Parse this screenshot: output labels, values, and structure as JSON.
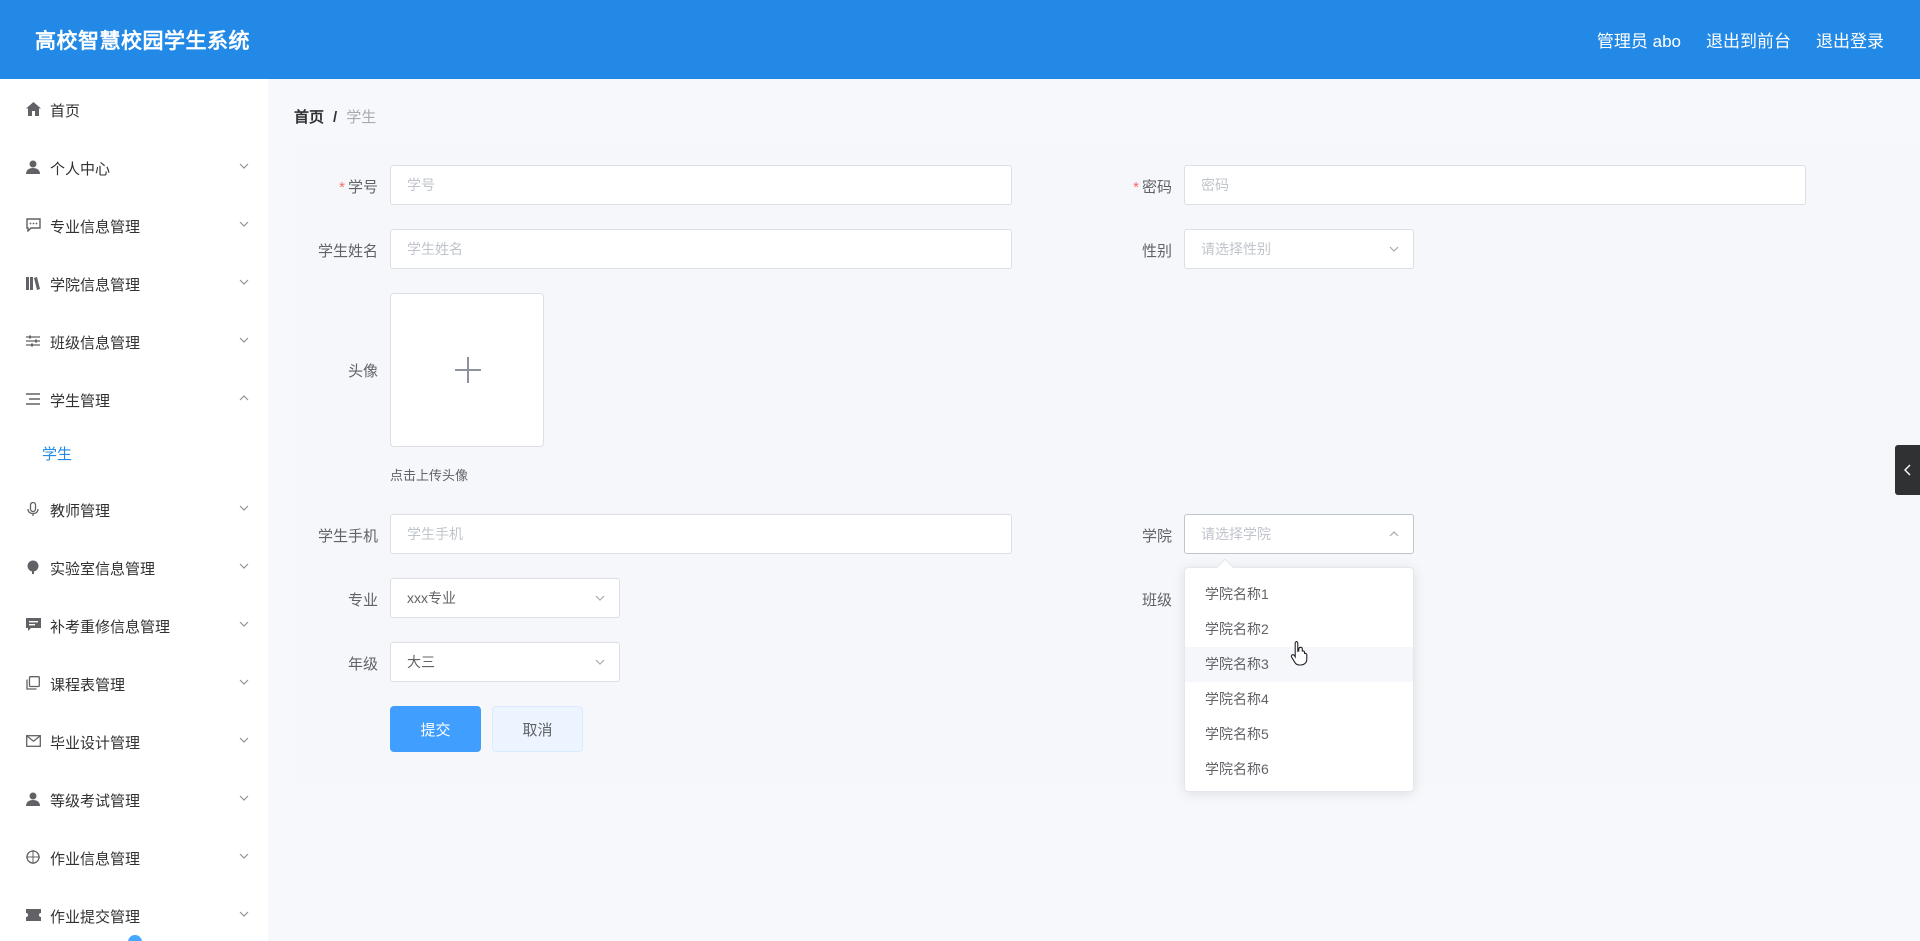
{
  "header": {
    "title": "高校智慧校园学生系统",
    "admin": "管理员 abo",
    "to_front": "退出到前台",
    "logout": "退出登录"
  },
  "sidebar": {
    "items": [
      {
        "label": "首页",
        "icon": "home-icon"
      },
      {
        "label": "个人中心",
        "icon": "user-icon"
      },
      {
        "label": "专业信息管理",
        "icon": "chat-icon"
      },
      {
        "label": "学院信息管理",
        "icon": "books-icon"
      },
      {
        "label": "班级信息管理",
        "icon": "sliders-icon"
      },
      {
        "label": "学生管理",
        "icon": "list-icon"
      },
      {
        "label": "教师管理",
        "icon": "microphone-icon"
      },
      {
        "label": "实验室信息管理",
        "icon": "flask-icon"
      },
      {
        "label": "补考重修信息管理",
        "icon": "message-icon"
      },
      {
        "label": "课程表管理",
        "icon": "copy-icon"
      },
      {
        "label": "毕业设计管理",
        "icon": "mail-icon"
      },
      {
        "label": "等级考试管理",
        "icon": "user-icon"
      },
      {
        "label": "作业信息管理",
        "icon": "target-icon"
      },
      {
        "label": "作业提交管理",
        "icon": "ticket-icon"
      }
    ],
    "sub_item": "学生"
  },
  "breadcrumb": {
    "home": "首页",
    "sep": "/",
    "current": "学生"
  },
  "form": {
    "student_no": {
      "label": "学号",
      "placeholder": "学号",
      "required": "*"
    },
    "password": {
      "label": "密码",
      "placeholder": "密码",
      "required": "*"
    },
    "name": {
      "label": "学生姓名",
      "placeholder": "学生姓名"
    },
    "gender": {
      "label": "性别",
      "placeholder": "请选择性别"
    },
    "avatar": {
      "label": "头像",
      "hint": "点击上传头像"
    },
    "phone": {
      "label": "学生手机",
      "placeholder": "学生手机"
    },
    "college": {
      "label": "学院",
      "placeholder": "请选择学院"
    },
    "major": {
      "label": "专业",
      "value": "xxx专业"
    },
    "class": {
      "label": "班级"
    },
    "grade": {
      "label": "年级",
      "value": "大三"
    },
    "submit": "提交",
    "cancel": "取消"
  },
  "college_dropdown": {
    "options": [
      "学院名称1",
      "学院名称2",
      "学院名称3",
      "学院名称4",
      "学院名称5",
      "学院名称6"
    ],
    "hovered": "学院名称3"
  },
  "colors": {
    "header": "#2389e6",
    "primary": "#409eff",
    "required": "#f56c6c"
  }
}
